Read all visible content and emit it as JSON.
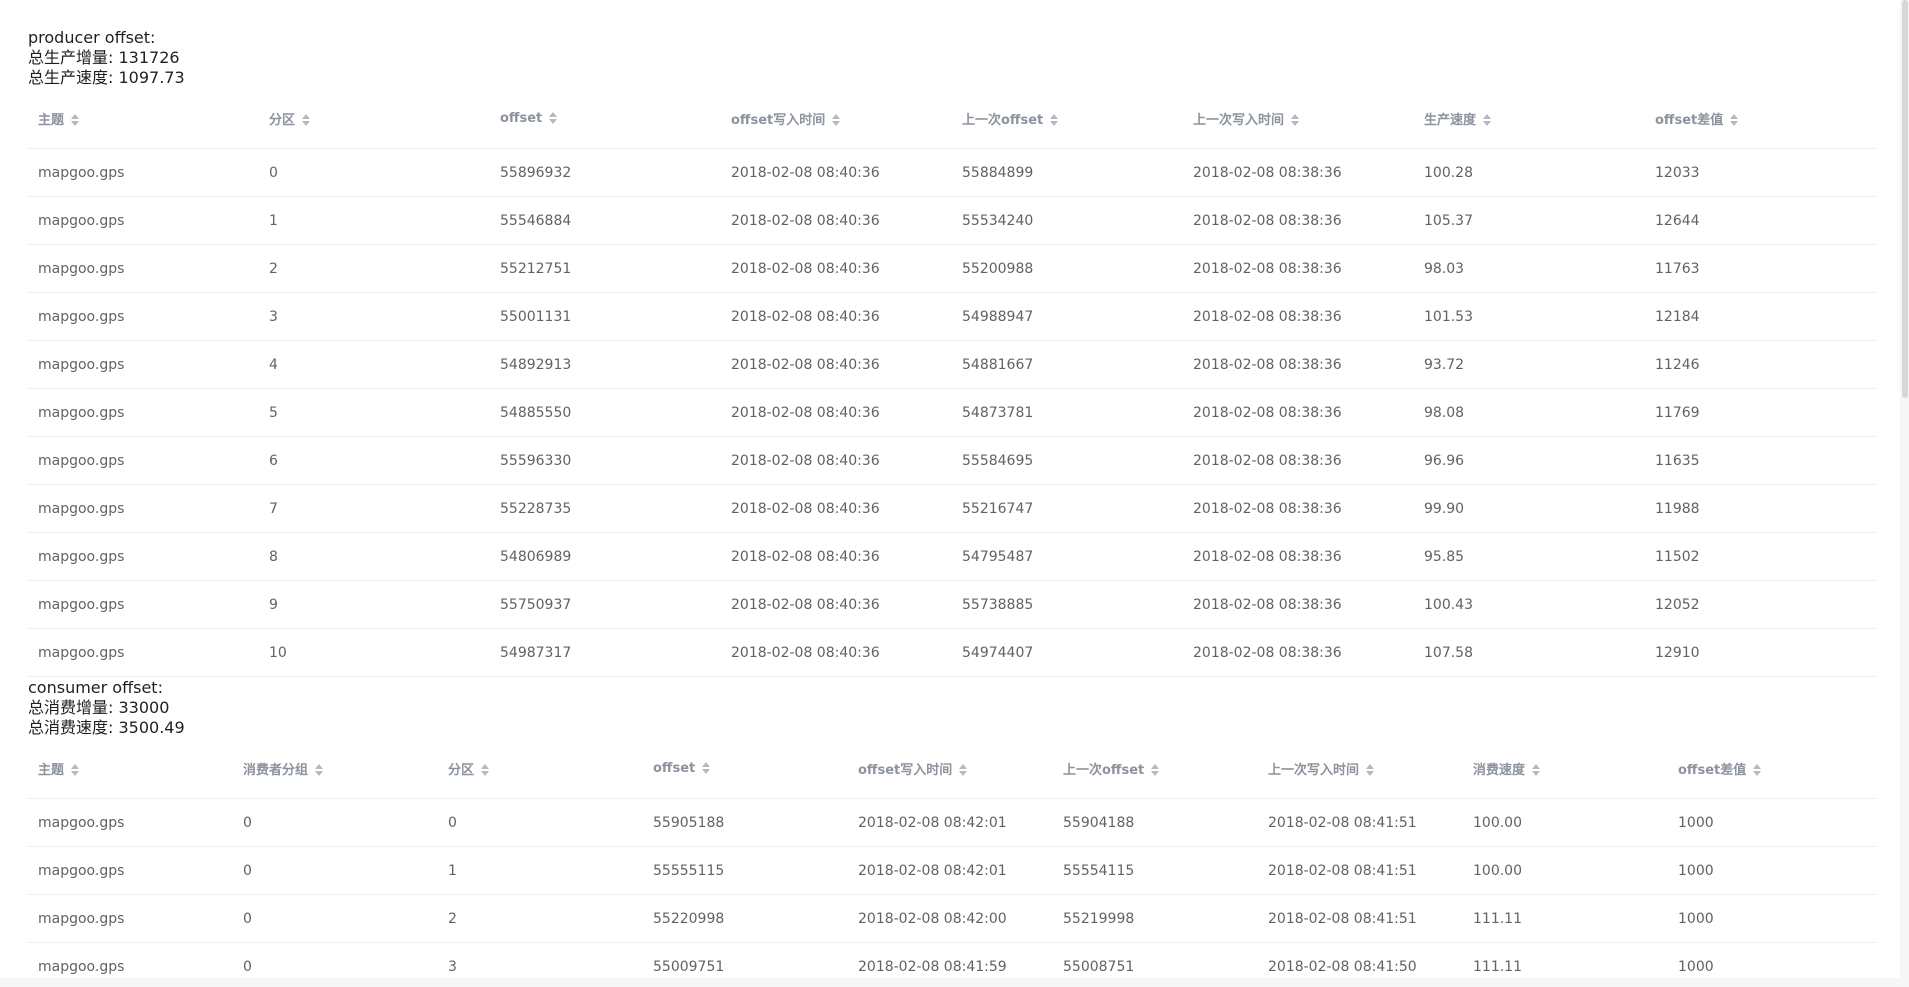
{
  "producer": {
    "title": "producer offset:",
    "total_increment_label": "总生产增量: 131726",
    "total_speed_label": "总生产速度: 1097.73",
    "columns": [
      "主题",
      "分区",
      "offset",
      "offset写入时间",
      "上一次offset",
      "上一次写入时间",
      "生产速度",
      "offset差值"
    ],
    "rows": [
      [
        "mapgoo.gps",
        "0",
        "55896932",
        "2018-02-08 08:40:36",
        "55884899",
        "2018-02-08 08:38:36",
        "100.28",
        "12033"
      ],
      [
        "mapgoo.gps",
        "1",
        "55546884",
        "2018-02-08 08:40:36",
        "55534240",
        "2018-02-08 08:38:36",
        "105.37",
        "12644"
      ],
      [
        "mapgoo.gps",
        "2",
        "55212751",
        "2018-02-08 08:40:36",
        "55200988",
        "2018-02-08 08:38:36",
        "98.03",
        "11763"
      ],
      [
        "mapgoo.gps",
        "3",
        "55001131",
        "2018-02-08 08:40:36",
        "54988947",
        "2018-02-08 08:38:36",
        "101.53",
        "12184"
      ],
      [
        "mapgoo.gps",
        "4",
        "54892913",
        "2018-02-08 08:40:36",
        "54881667",
        "2018-02-08 08:38:36",
        "93.72",
        "11246"
      ],
      [
        "mapgoo.gps",
        "5",
        "54885550",
        "2018-02-08 08:40:36",
        "54873781",
        "2018-02-08 08:38:36",
        "98.08",
        "11769"
      ],
      [
        "mapgoo.gps",
        "6",
        "55596330",
        "2018-02-08 08:40:36",
        "55584695",
        "2018-02-08 08:38:36",
        "96.96",
        "11635"
      ],
      [
        "mapgoo.gps",
        "7",
        "55228735",
        "2018-02-08 08:40:36",
        "55216747",
        "2018-02-08 08:38:36",
        "99.90",
        "11988"
      ],
      [
        "mapgoo.gps",
        "8",
        "54806989",
        "2018-02-08 08:40:36",
        "54795487",
        "2018-02-08 08:38:36",
        "95.85",
        "11502"
      ],
      [
        "mapgoo.gps",
        "9",
        "55750937",
        "2018-02-08 08:40:36",
        "55738885",
        "2018-02-08 08:38:36",
        "100.43",
        "12052"
      ],
      [
        "mapgoo.gps",
        "10",
        "54987317",
        "2018-02-08 08:40:36",
        "54974407",
        "2018-02-08 08:38:36",
        "107.58",
        "12910"
      ]
    ]
  },
  "consumer": {
    "title": "consumer offset:",
    "total_increment_label": "总消费增量: 33000",
    "total_speed_label": "总消费速度: 3500.49",
    "columns": [
      "主题",
      "消费者分组",
      "分区",
      "offset",
      "offset写入时间",
      "上一次offset",
      "上一次写入时间",
      "消费速度",
      "offset差值"
    ],
    "rows": [
      [
        "mapgoo.gps",
        "0",
        "0",
        "55905188",
        "2018-02-08 08:42:01",
        "55904188",
        "2018-02-08 08:41:51",
        "100.00",
        "1000"
      ],
      [
        "mapgoo.gps",
        "0",
        "1",
        "55555115",
        "2018-02-08 08:42:01",
        "55554115",
        "2018-02-08 08:41:51",
        "100.00",
        "1000"
      ],
      [
        "mapgoo.gps",
        "0",
        "2",
        "55220998",
        "2018-02-08 08:42:00",
        "55219998",
        "2018-02-08 08:41:51",
        "111.11",
        "1000"
      ],
      [
        "mapgoo.gps",
        "0",
        "3",
        "55009751",
        "2018-02-08 08:41:59",
        "55008751",
        "2018-02-08 08:41:50",
        "111.11",
        "1000"
      ]
    ]
  }
}
